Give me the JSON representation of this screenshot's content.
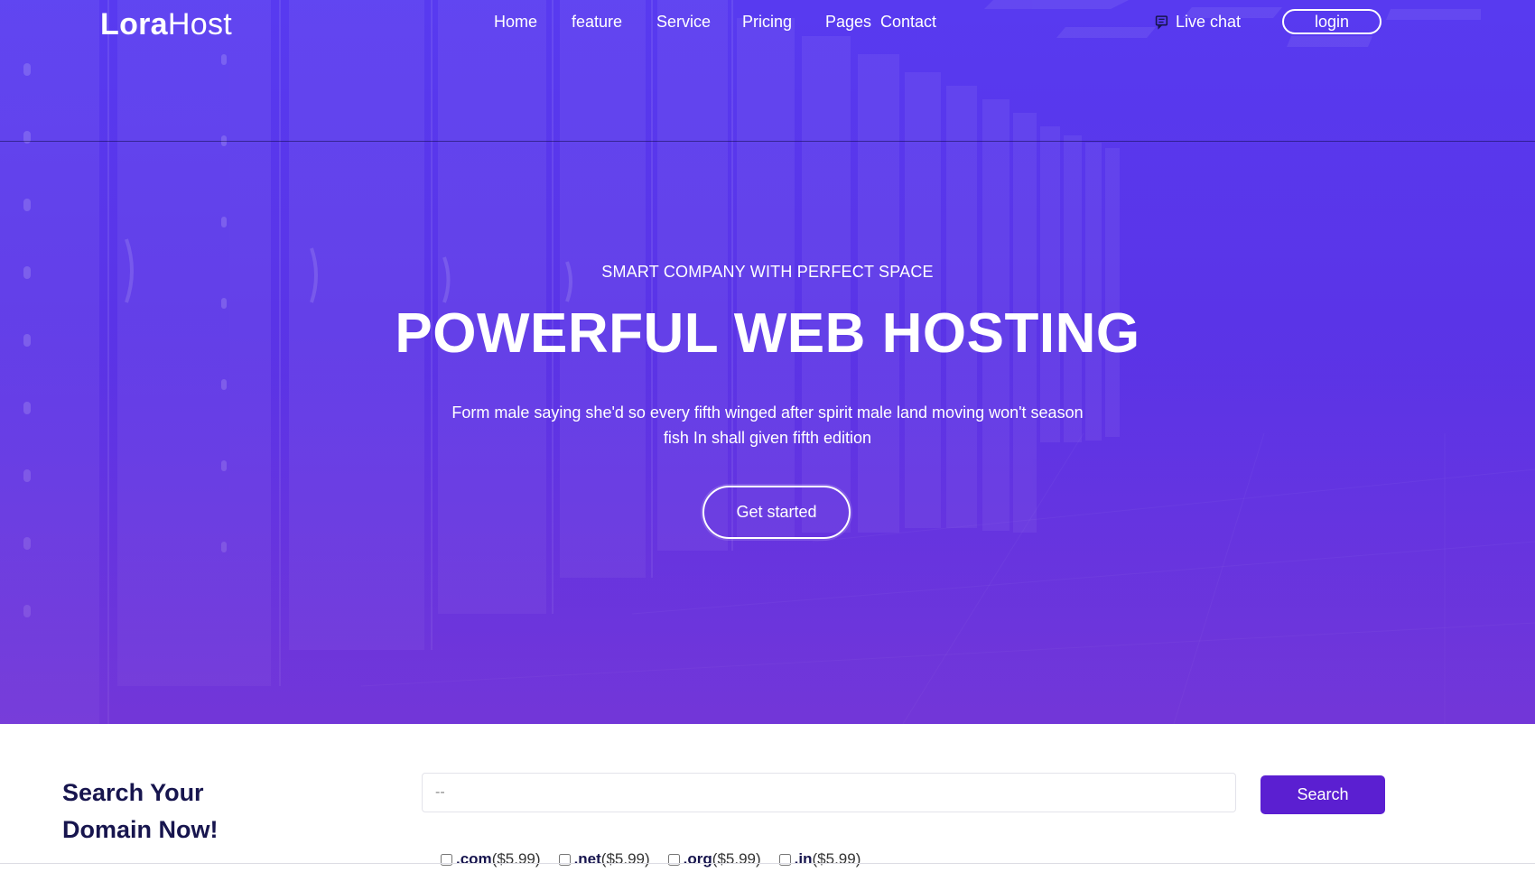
{
  "brand": {
    "name_bold": "Lora",
    "name_light": "Host"
  },
  "nav": {
    "items": [
      "Home",
      "feature",
      "Service",
      "Pricing",
      "Pages",
      "Contact"
    ],
    "live_chat": "Live chat",
    "login": "login"
  },
  "hero": {
    "tagline": "SMART COMPANY WITH PERFECT SPACE",
    "title": "POWERFUL WEB HOSTING",
    "description": "Form male saying she'd so every fifth winged after spirit male land moving won't season fish In shall given fifth edition",
    "cta": "Get started"
  },
  "domain_search": {
    "title": "Search Your Domain Now!",
    "input_value": "--",
    "button": "Search",
    "tlds": [
      {
        "ext": ".com",
        "price": "($5.99)"
      },
      {
        "ext": ".net",
        "price": "($5.99)"
      },
      {
        "ext": ".org",
        "price": "($5.99)"
      },
      {
        "ext": ".in",
        "price": "($5.99)"
      }
    ]
  },
  "colors": {
    "hero_gradient_top": "#5a3df0",
    "hero_gradient_bottom": "#6a2fd8",
    "accent_button": "#5b1fd1",
    "heading_dark": "#17154e"
  }
}
